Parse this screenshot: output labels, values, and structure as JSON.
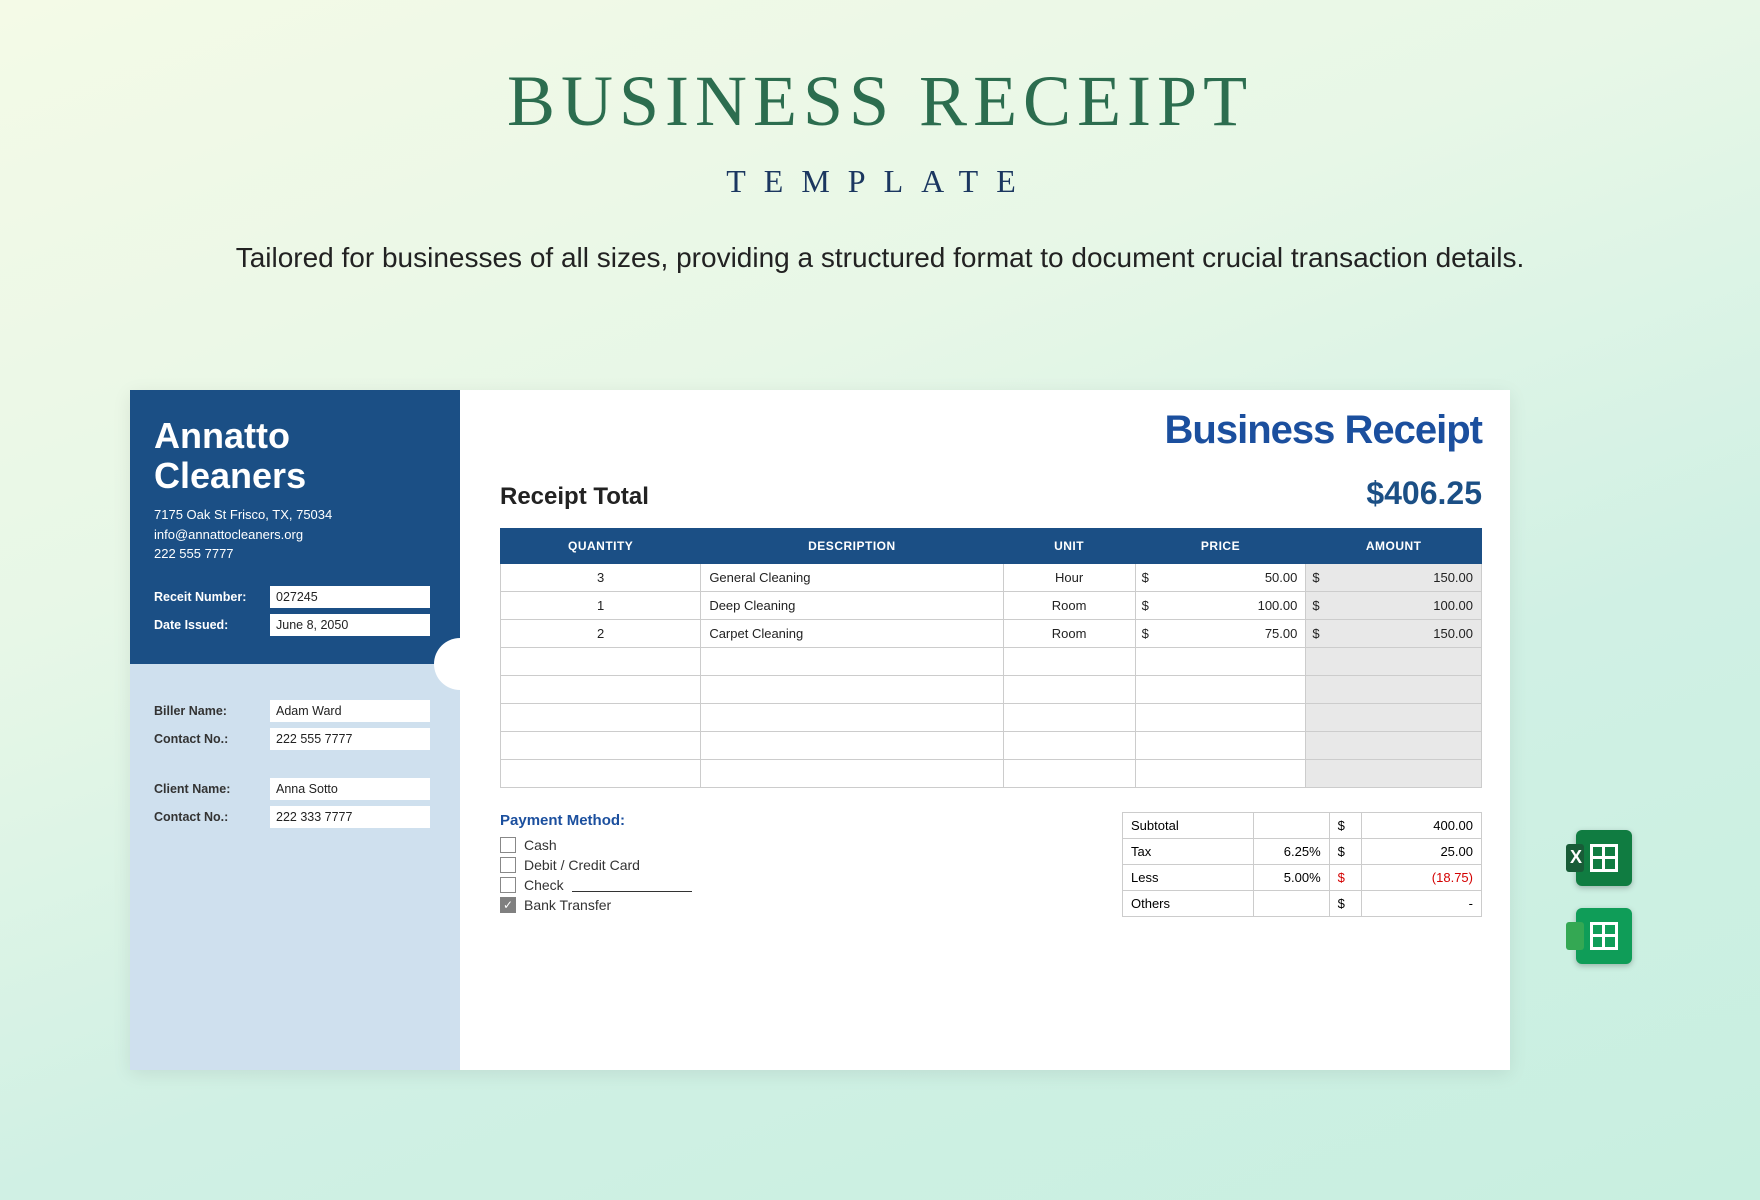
{
  "page": {
    "title": "BUSINESS RECEIPT",
    "subtitle": "TEMPLATE",
    "description": "Tailored for businesses of all sizes, providing a structured format to document crucial transaction details."
  },
  "company": {
    "name": "Annatto Cleaners",
    "address": "7175 Oak St Frisco, TX, 75034",
    "email": "info@annattocleaners.org",
    "phone": "222 555 7777"
  },
  "receipt": {
    "number_label": "Receit Number:",
    "number": "027245",
    "date_label": "Date Issued:",
    "date": "June 8, 2050"
  },
  "biller": {
    "name_label": "Biller Name:",
    "name": "Adam Ward",
    "contact_label": "Contact No.:",
    "contact": "222 555 7777"
  },
  "client": {
    "name_label": "Client Name:",
    "name": "Anna Sotto",
    "contact_label": "Contact No.:",
    "contact": "222 333 7777"
  },
  "main": {
    "heading": "Business Receipt",
    "total_label": "Receipt Total",
    "total_amount": "$406.25"
  },
  "table": {
    "headers": {
      "qty": "QUANTITY",
      "desc": "DESCRIPTION",
      "unit": "UNIT",
      "price": "PRICE",
      "amount": "AMOUNT"
    },
    "rows": [
      {
        "qty": "3",
        "desc": "General Cleaning",
        "unit": "Hour",
        "price": "50.00",
        "amount": "150.00"
      },
      {
        "qty": "1",
        "desc": "Deep Cleaning",
        "unit": "Room",
        "price": "100.00",
        "amount": "100.00"
      },
      {
        "qty": "2",
        "desc": "Carpet Cleaning",
        "unit": "Room",
        "price": "75.00",
        "amount": "150.00"
      }
    ],
    "blank_rows": 5,
    "currency": "$"
  },
  "payment": {
    "title": "Payment Method:",
    "options": [
      {
        "label": "Cash",
        "checked": false,
        "line": false
      },
      {
        "label": "Debit / Credit Card",
        "checked": false,
        "line": false
      },
      {
        "label": "Check",
        "checked": false,
        "line": true
      },
      {
        "label": "Bank Transfer",
        "checked": true,
        "line": false
      }
    ]
  },
  "totals": {
    "rows": [
      {
        "label": "Subtotal",
        "pct": "",
        "cur": "$",
        "val": "400.00",
        "neg": false
      },
      {
        "label": "Tax",
        "pct": "6.25%",
        "cur": "$",
        "val": "25.00",
        "neg": false
      },
      {
        "label": "Less",
        "pct": "5.00%",
        "cur": "$",
        "val": "(18.75)",
        "neg": true
      },
      {
        "label": "Others",
        "pct": "",
        "cur": "$",
        "val": "-",
        "neg": false
      }
    ]
  },
  "formats": {
    "excel": "Excel",
    "sheets": "Google Sheets"
  }
}
